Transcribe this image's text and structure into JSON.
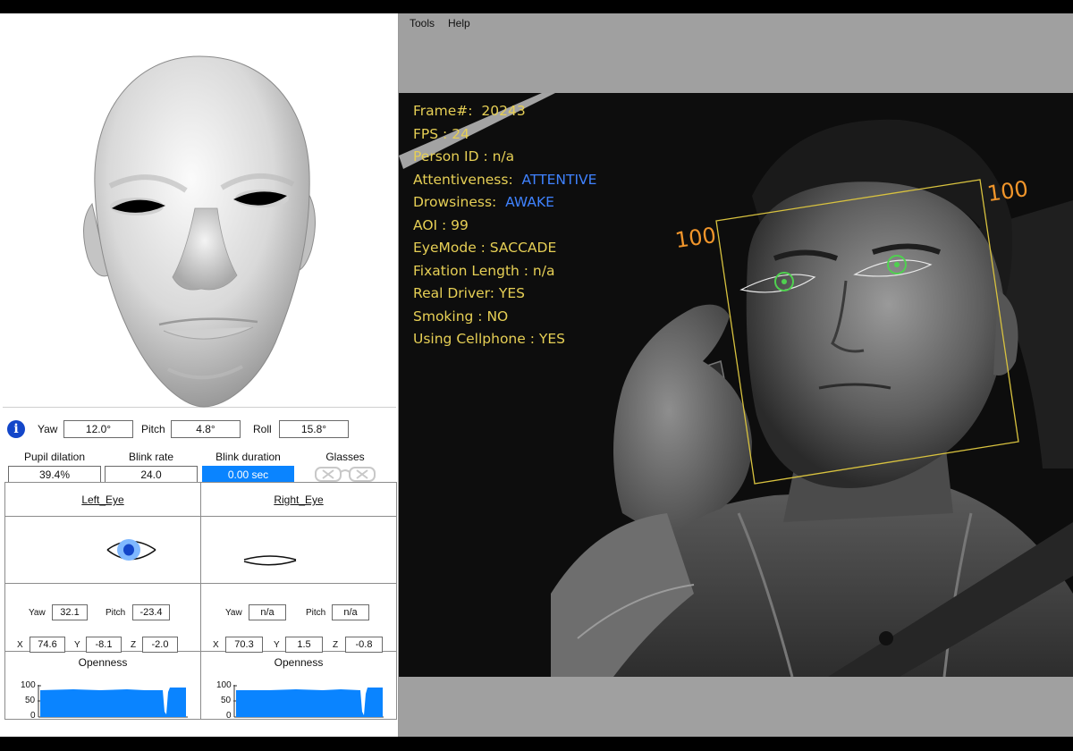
{
  "menu": {
    "tools": "Tools",
    "help": "Help"
  },
  "pose": {
    "yaw_label": "Yaw",
    "yaw_value": "12.0°",
    "pitch_label": "Pitch",
    "pitch_value": "4.8°",
    "roll_label": "Roll",
    "roll_value": "15.8°"
  },
  "metrics": {
    "pupil_label": "Pupil dilation",
    "pupil_value": "39.4%",
    "blink_rate_label": "Blink rate",
    "blink_rate_value": "24.0",
    "blink_duration_label": "Blink duration",
    "blink_duration_value": "0.00 sec",
    "glasses_label": "Glasses"
  },
  "left_eye": {
    "title": "Left_Eye",
    "yaw_label": "Yaw",
    "yaw_value": "32.1",
    "pitch_label": "Pitch",
    "pitch_value": "-23.4",
    "x_label": "X",
    "x_value": "74.6",
    "y_label": "Y",
    "y_value": "-8.1",
    "z_label": "Z",
    "z_value": "-2.0",
    "openness_label": "Openness",
    "state": "open"
  },
  "right_eye": {
    "title": "Right_Eye",
    "yaw_label": "Yaw",
    "yaw_value": "n/a",
    "pitch_label": "Pitch",
    "pitch_value": "n/a",
    "x_label": "X",
    "x_value": "70.3",
    "y_label": "Y",
    "y_value": "1.5",
    "z_label": "Z",
    "z_value": "-0.8",
    "openness_label": "Openness",
    "state": "closed"
  },
  "openness_axis": {
    "t100": "100",
    "t50": "50",
    "t0": "0"
  },
  "overlay": {
    "frame_label": "Frame#:",
    "frame_value": "20243",
    "fps_label": "FPS :",
    "fps_value": "24",
    "person_id": "Person ID : n/a",
    "attentiveness_label": "Attentiveness:",
    "attentiveness_value": "ATTENTIVE",
    "drowsiness_label": "Drowsiness:",
    "drowsiness_value": "AWAKE",
    "aoi": "AOI : 99",
    "eyemode": "EyeMode : SACCADE",
    "fixation": "Fixation Length : n/a",
    "real_driver": "Real Driver: YES",
    "smoking": "Smoking : NO",
    "cellphone": "Using Cellphone : YES"
  },
  "face_box": {
    "left_score": "100",
    "right_score": "100"
  },
  "colors": {
    "accent_blue": "#0a84ff",
    "overlay_yellow": "#e6cf55",
    "overlay_blue": "#3f82ff",
    "score_orange": "#f0952b"
  }
}
